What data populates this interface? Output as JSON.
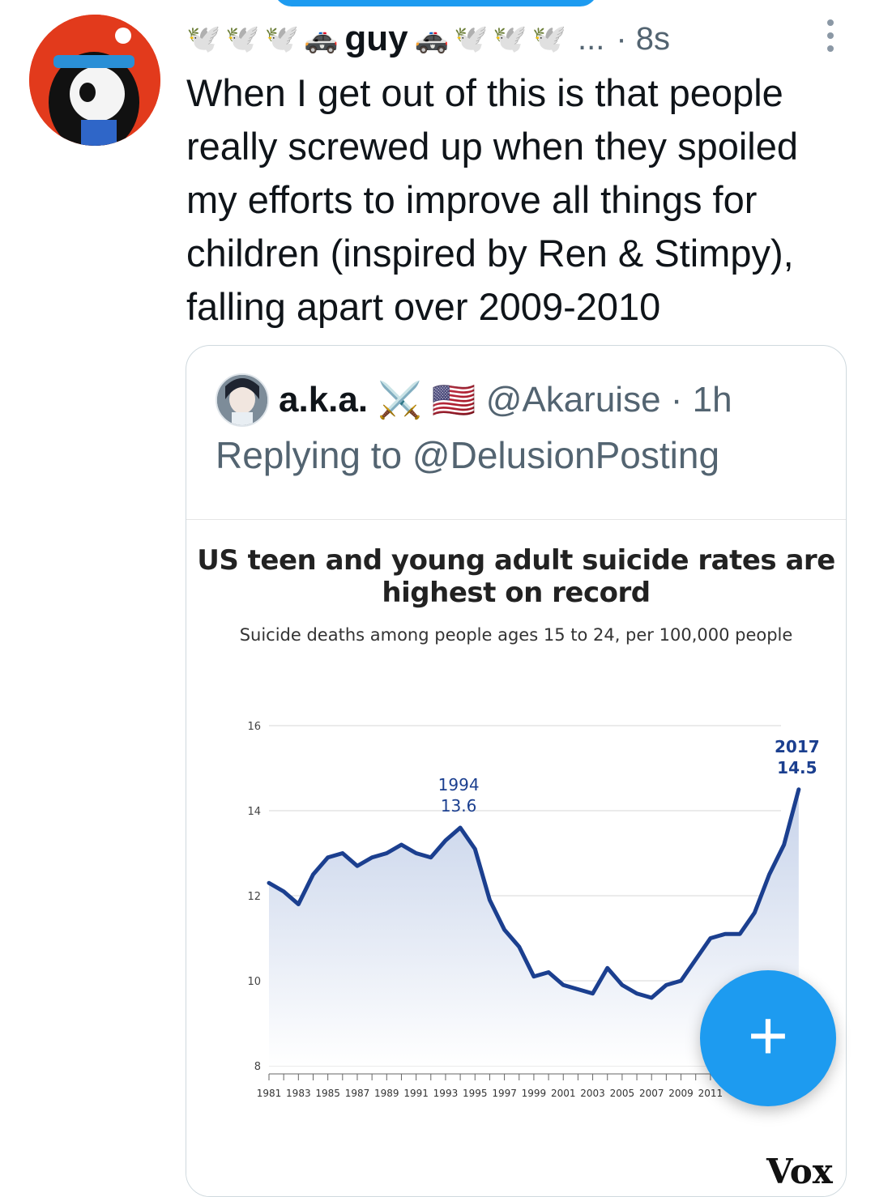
{
  "tweet": {
    "display_name": "guy",
    "decor_left": [
      "🕊️",
      "🕊️",
      "🕊️",
      "🚓"
    ],
    "decor_right": [
      "🚓",
      "🕊️",
      "🕊️",
      "🕊️"
    ],
    "ellipsis": "...",
    "time": "· 8s",
    "text": "When I get out of this is that people really screwed up when they spoiled my efforts to improve all things for children (inspired by Ren & Stimpy), falling apart over 2009-2010"
  },
  "quote": {
    "name": "a.k.a.",
    "emoji": [
      "⚔️",
      "🇺🇸"
    ],
    "handle_time": "@Akaruise · 1h",
    "replying_prefix": "Replying to ",
    "replying_handle": "@DelusionPosting"
  },
  "chart_data": {
    "type": "area",
    "title": "US teen and young adult suicide rates are highest on record",
    "subtitle": "Suicide deaths among people ages 15 to 24, per 100,000 people",
    "ylim": [
      8,
      16
    ],
    "y_ticks": [
      "16",
      "14",
      "12",
      "10",
      "8"
    ],
    "x_tick_labels": [
      "1981",
      "1983",
      "1985",
      "1987",
      "1989",
      "1991",
      "1993",
      "1995",
      "1997",
      "1999",
      "2001",
      "2003",
      "2005",
      "2007",
      "2009",
      "2011",
      "20"
    ],
    "x": [
      1981,
      1982,
      1983,
      1984,
      1985,
      1986,
      1987,
      1988,
      1989,
      1990,
      1991,
      1992,
      1993,
      1994,
      1995,
      1996,
      1997,
      1998,
      1999,
      2000,
      2001,
      2002,
      2003,
      2004,
      2005,
      2006,
      2007,
      2008,
      2009,
      2010,
      2011,
      2012,
      2013,
      2014,
      2015,
      2016,
      2017
    ],
    "values": [
      12.3,
      12.1,
      11.8,
      12.5,
      12.9,
      13.0,
      12.7,
      12.9,
      13.0,
      13.2,
      13.0,
      12.9,
      13.3,
      13.6,
      13.1,
      11.9,
      11.2,
      10.8,
      10.1,
      10.2,
      9.9,
      9.8,
      9.7,
      10.3,
      9.9,
      9.7,
      9.6,
      9.9,
      10.0,
      10.5,
      11.0,
      11.1,
      11.1,
      11.6,
      12.5,
      13.2,
      14.5
    ],
    "annotations": [
      {
        "year": "1994",
        "value": "13.6"
      },
      {
        "year": "2017",
        "value": "14.5"
      }
    ],
    "line_color": "#1b3f8f",
    "fill_color": "#c7d3ea"
  },
  "brand": "Vox",
  "fab": {
    "label": "+"
  },
  "colors": {
    "accent": "#1d9bf0",
    "muted": "#536471"
  }
}
